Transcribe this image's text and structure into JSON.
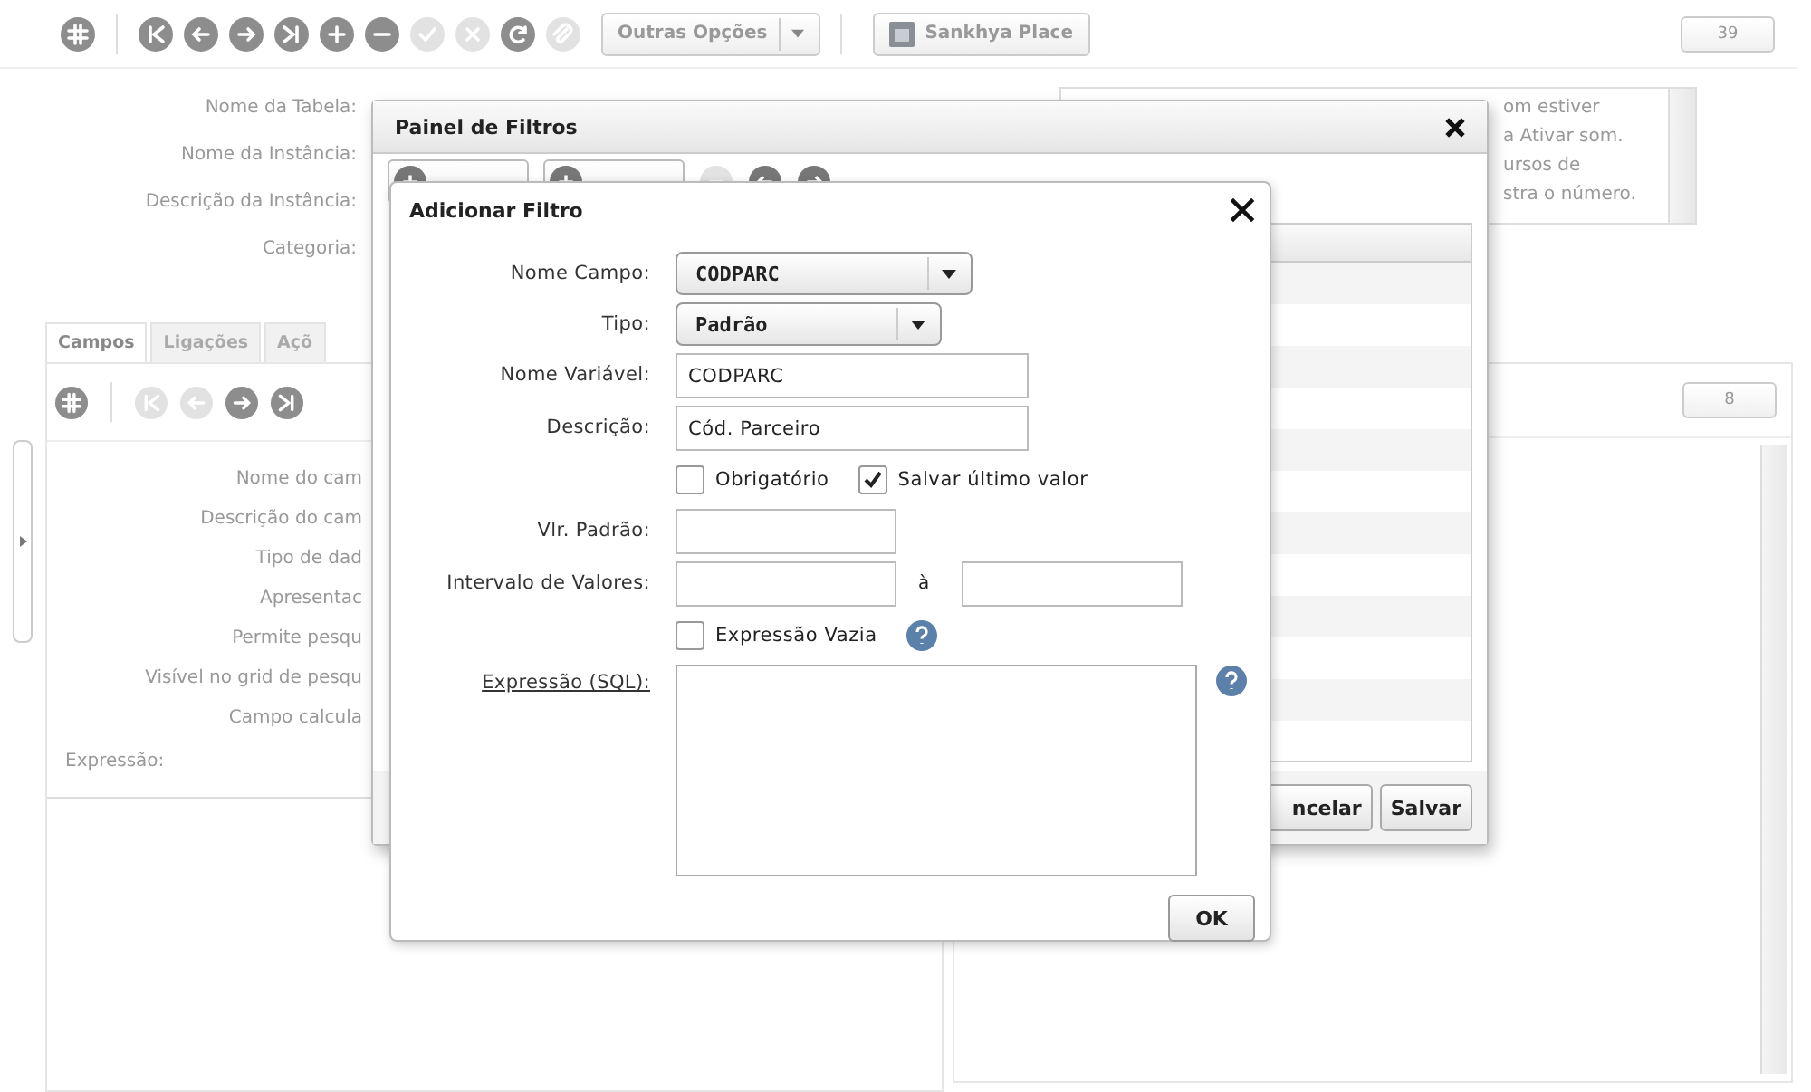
{
  "toolbar": {
    "buttons": [
      {
        "kind": "grid",
        "disabled": false
      },
      {
        "kind": "first",
        "disabled": false
      },
      {
        "kind": "prev",
        "disabled": false
      },
      {
        "kind": "next",
        "disabled": false
      },
      {
        "kind": "last",
        "disabled": false
      },
      {
        "kind": "add",
        "disabled": false
      },
      {
        "kind": "remove",
        "disabled": false
      },
      {
        "kind": "confirm",
        "disabled": true
      },
      {
        "kind": "cancel",
        "disabled": true
      },
      {
        "kind": "refresh",
        "disabled": false
      },
      {
        "kind": "attach",
        "disabled": true
      }
    ],
    "options_button": "Outras Opções",
    "place_button": "Sankhya Place",
    "count": "39"
  },
  "instance_form": {
    "labels": [
      "Nome da Tabela:",
      "Nome da Instância:",
      "Descrição da Instância:",
      "Categoria:"
    ],
    "notes": [
      "om estiver",
      "a Ativar som.",
      "ursos de",
      "stra o número."
    ]
  },
  "tabs": [
    {
      "label": "Campos",
      "selected": true
    },
    {
      "label": "Ligações",
      "selected": false
    },
    {
      "label": "Açõ",
      "selected": false
    }
  ],
  "fields_toolbar": {
    "buttons": [
      {
        "kind": "grid",
        "disabled": false
      },
      {
        "kind": "first",
        "disabled": true
      },
      {
        "kind": "prev",
        "disabled": true
      },
      {
        "kind": "next",
        "disabled": false
      },
      {
        "kind": "last",
        "disabled": false
      }
    ],
    "count": "8"
  },
  "field_labels": [
    "Nome do cam",
    "Descrição do cam",
    "Tipo de dad",
    "Apresentac",
    "Permite pesqu",
    "Visível no grid de pesqu",
    "Campo calcula"
  ],
  "expression_label": "Expressão:",
  "filter_panel": {
    "title": "Painel de Filtros",
    "buttons": [
      {
        "kind": "add",
        "disabled": false
      },
      {
        "kind": "add",
        "disabled": false
      },
      {
        "kind": "remove",
        "disabled": true
      },
      {
        "kind": "prev",
        "disabled": false
      },
      {
        "kind": "next",
        "disabled": false
      }
    ],
    "footer_buttons": [
      "ncelar",
      "Salvar"
    ]
  },
  "add_filter": {
    "title": "Adicionar Filtro",
    "fields": [
      {
        "kind": "select",
        "label": "Nome Campo:",
        "value": "CODPARC"
      },
      {
        "kind": "select",
        "label": "Tipo:",
        "value": "Padrão"
      },
      {
        "kind": "input",
        "label": "Nome Variável:",
        "value": "CODPARC"
      },
      {
        "kind": "input",
        "label": "Descrição:",
        "value": "Cód. Parceiro"
      },
      {
        "kind": "checks",
        "options": [
          {
            "label": "Obrigatório",
            "checked": false
          },
          {
            "label": "Salvar último valor",
            "checked": true
          }
        ]
      },
      {
        "kind": "short",
        "label": "Vlr. Padrão:"
      },
      {
        "kind": "range",
        "label": "Intervalo de Valores:",
        "separator": "à"
      },
      {
        "kind": "checks_help",
        "options": [
          {
            "label": "Expressão Vazia",
            "checked": false
          }
        ]
      },
      {
        "kind": "sql",
        "label": "Expressão (SQL):"
      }
    ],
    "ok_button": "OK"
  }
}
